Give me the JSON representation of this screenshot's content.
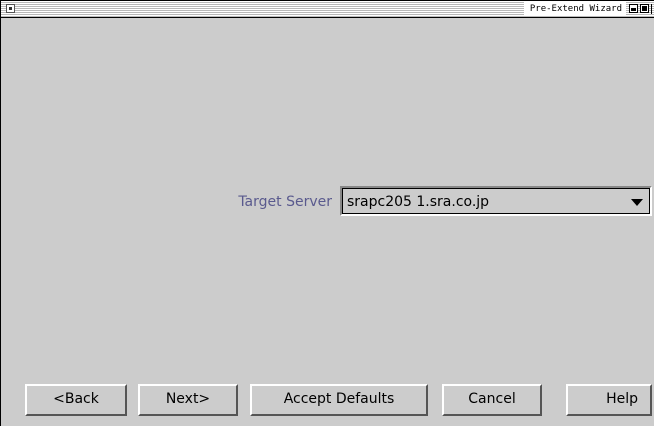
{
  "window": {
    "title": "Pre-Extend Wizard"
  },
  "form": {
    "target_server_label": "Target Server",
    "target_server_value": "srapc205 1.sra.co.jp"
  },
  "buttons": {
    "back": "<Back",
    "next": "Next>",
    "accept_defaults": "Accept Defaults",
    "cancel": "Cancel",
    "help": "Help"
  },
  "icons": {
    "close": "close-box-icon",
    "minimize": "minimize-icon",
    "maximize": "maximize-icon",
    "dropdown": "chevron-down-icon"
  },
  "colors": {
    "background": "#cccccc",
    "label": "#5a5a8e"
  }
}
